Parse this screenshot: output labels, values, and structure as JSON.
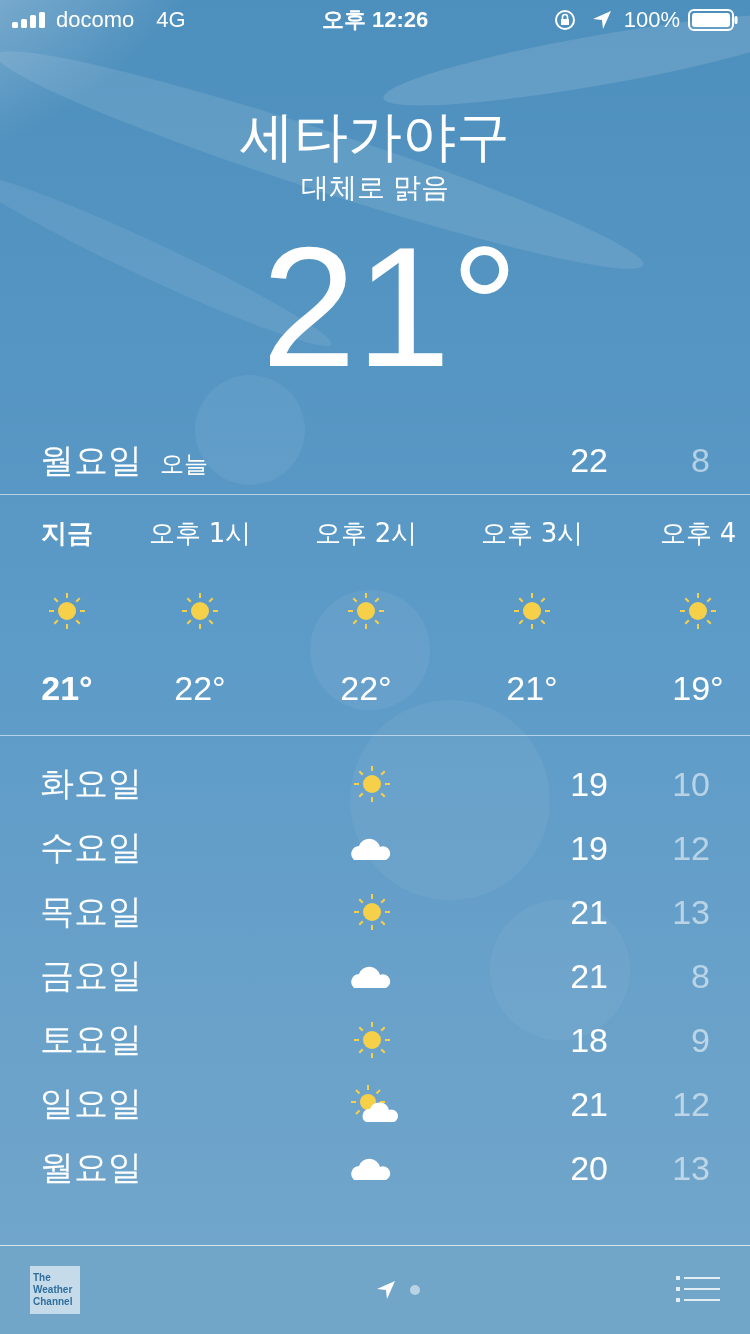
{
  "status_bar": {
    "carrier": "docomo",
    "network": "4G",
    "time": "오후 12:26",
    "battery": "100%"
  },
  "location": {
    "city": "세타가야구",
    "condition": "대체로 맑음",
    "temperature": "21°"
  },
  "today": {
    "day": "월요일",
    "label": "오늘",
    "high": "22",
    "low": "8"
  },
  "hourly": [
    {
      "time": "지금",
      "kind": "sun",
      "temp": "21°",
      "now": true
    },
    {
      "time": "오후 1시",
      "kind": "sun",
      "temp": "22°",
      "now": false
    },
    {
      "time": "오후 2시",
      "kind": "sun",
      "temp": "22°",
      "now": false
    },
    {
      "time": "오후 3시",
      "kind": "sun",
      "temp": "21°",
      "now": false
    },
    {
      "time": "오후 4",
      "kind": "sun",
      "temp": "19°",
      "now": false
    }
  ],
  "daily": [
    {
      "day": "화요일",
      "kind": "sun",
      "high": "19",
      "low": "10"
    },
    {
      "day": "수요일",
      "kind": "cloud",
      "high": "19",
      "low": "12"
    },
    {
      "day": "목요일",
      "kind": "sun",
      "high": "21",
      "low": "13"
    },
    {
      "day": "금요일",
      "kind": "cloud",
      "high": "21",
      "low": "8"
    },
    {
      "day": "토요일",
      "kind": "sun",
      "high": "18",
      "low": "9"
    },
    {
      "day": "일요일",
      "kind": "partly",
      "high": "21",
      "low": "12"
    },
    {
      "day": "월요일",
      "kind": "cloud",
      "high": "20",
      "low": "13"
    }
  ],
  "footer": {
    "logo": [
      "The",
      "Weather",
      "Channel"
    ]
  }
}
